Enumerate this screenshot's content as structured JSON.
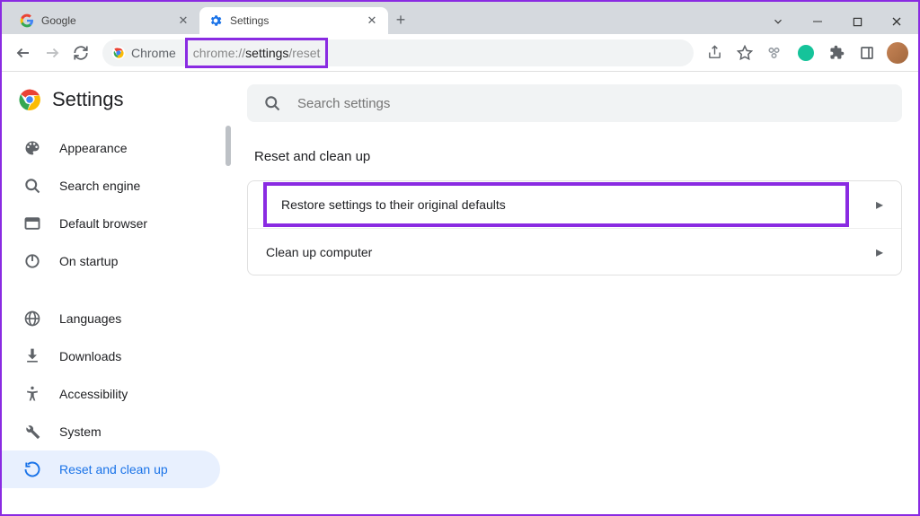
{
  "window": {
    "tabs": [
      {
        "title": "Google",
        "icon": "google",
        "active": false
      },
      {
        "title": "Settings",
        "icon": "chrome-settings",
        "active": true
      }
    ]
  },
  "toolbar": {
    "site_chip": "Chrome",
    "url_prefix": "chrome://",
    "url_emphasis": "settings",
    "url_suffix": "/reset"
  },
  "colors": {
    "highlight": "#8a2be2",
    "chrome_blue": "#1a73e8"
  },
  "sidebar": {
    "title": "Settings",
    "items": [
      {
        "label": "Appearance",
        "icon": "palette",
        "active": false
      },
      {
        "label": "Search engine",
        "icon": "search",
        "active": false
      },
      {
        "label": "Default browser",
        "icon": "default-browser",
        "active": false
      },
      {
        "label": "On startup",
        "icon": "power",
        "active": false
      },
      {
        "gap": true
      },
      {
        "label": "Languages",
        "icon": "globe",
        "active": false
      },
      {
        "label": "Downloads",
        "icon": "download",
        "active": false
      },
      {
        "label": "Accessibility",
        "icon": "accessibility",
        "active": false
      },
      {
        "label": "System",
        "icon": "wrench",
        "active": false
      },
      {
        "label": "Reset and clean up",
        "icon": "restore",
        "active": true
      }
    ]
  },
  "content": {
    "search_placeholder": "Search settings",
    "section_title": "Reset and clean up",
    "rows": [
      {
        "label": "Restore settings to their original defaults",
        "highlighted": true
      },
      {
        "label": "Clean up computer",
        "highlighted": false
      }
    ]
  }
}
